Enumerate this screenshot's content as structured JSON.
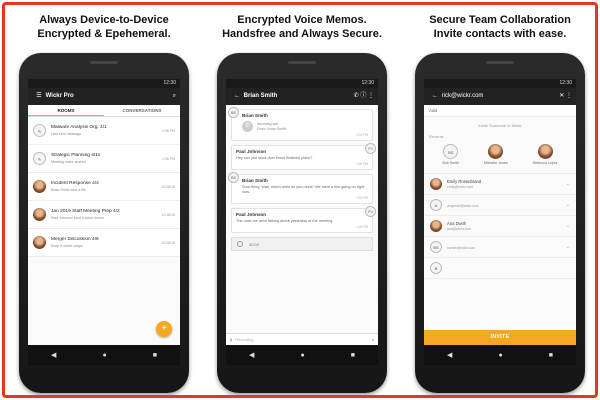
{
  "captions": [
    {
      "line1": "Always Device-to-Device",
      "line2": "Encrypted & Epehemeral."
    },
    {
      "line1": "Encrypted Voice Memos.",
      "line2": "Handsfree and Always Secure."
    },
    {
      "line1": "Secure Team Collaboration",
      "line2": "Invite contacts with ease."
    }
  ],
  "status_time": "12:30",
  "screen1": {
    "app_title": "Wickr Pro",
    "tabs": [
      "ROOMS",
      "CONVERSATIONS"
    ],
    "rooms": [
      {
        "title": "Malware Analysis Org. 4/1",
        "sub": "Last sent message",
        "time": "1:08 PM",
        "avatar_label": ""
      },
      {
        "title": "Strategic Planning 4/11",
        "sub": "Meeting notes shared",
        "time": "1:08 PM",
        "avatar_label": ""
      },
      {
        "title": "Incident Response 4/4",
        "sub": "Brian Smith sent a file",
        "time": "12/18/18",
        "avatar_label": ""
      },
      {
        "title": "Jan 2019 Staff Meeting Prep 4/2",
        "sub": "Paul Johnson sent a voice memo",
        "time": "12/18/18",
        "avatar_label": ""
      },
      {
        "title": "Merger Discussion 4/6",
        "sub": "Keep it under wraps",
        "time": "12/18/18",
        "avatar_label": ""
      }
    ],
    "fab_icon": "+"
  },
  "screen2": {
    "contact_name": "Brian Smith",
    "messages": [
      {
        "side": "left",
        "avatar": "BS",
        "name": "Brian Smith",
        "body": "Incoming call\nFrom: Brian Smith",
        "time": "1:01 PM",
        "voice": true
      },
      {
        "side": "right",
        "avatar": "PJ",
        "name": "Paul Johnson",
        "body": "Hey can you send over those finalized plans?",
        "time": "1:02 PM",
        "voice": false
      },
      {
        "side": "left",
        "avatar": "BS",
        "name": "Brian Smith",
        "body": "Sure thing. Wait, which ones do you need? We have a few going on right now.",
        "time": "1:03 PM",
        "voice": false
      },
      {
        "side": "right",
        "avatar": "PJ",
        "name": "Paul Johnson",
        "body": "The ones we were talking about yesterday at the meeting.",
        "time": "1:04 PM",
        "voice": false
      }
    ],
    "audio_duration": "00:03",
    "composer_placeholder": "Recording"
  },
  "screen3": {
    "search_value": "rick@wickr.com",
    "to_label": "Add",
    "invite_hint": "Invite Someone to Wickr",
    "section_label": "Recents",
    "recents": [
      {
        "initials": "BS",
        "name": "Bob Smith",
        "photo": false
      },
      {
        "initials": "",
        "name": "Michelle Jones",
        "photo": true
      },
      {
        "initials": "",
        "name": "Rebecca Lopez",
        "photo": true
      }
    ],
    "contacts": [
      {
        "initials": "",
        "name": "Emily Rosenbrand",
        "email": "emily@wickr.com",
        "photo": true
      },
      {
        "initials": "A",
        "name": "",
        "email": "amyreed@wickr.com",
        "photo": false
      },
      {
        "initials": "",
        "name": "Ana Dwith",
        "email": "ana@wickr.com",
        "photo": true
      },
      {
        "initials": "BS",
        "name": "",
        "email": "bsmith@wickr.com",
        "photo": false
      },
      {
        "initials": "B",
        "name": "",
        "email": "",
        "photo": false
      }
    ],
    "invite_button": "INVITE"
  },
  "colors": {
    "accent": "#f5a623",
    "frame": "#e8361f",
    "appbar": "#222222"
  },
  "icons": [
    "menu-icon",
    "search-icon",
    "back-icon",
    "phone-icon",
    "info-icon",
    "more-icon",
    "close-icon",
    "back-nav-icon",
    "home-nav-icon",
    "recents-nav-icon"
  ]
}
